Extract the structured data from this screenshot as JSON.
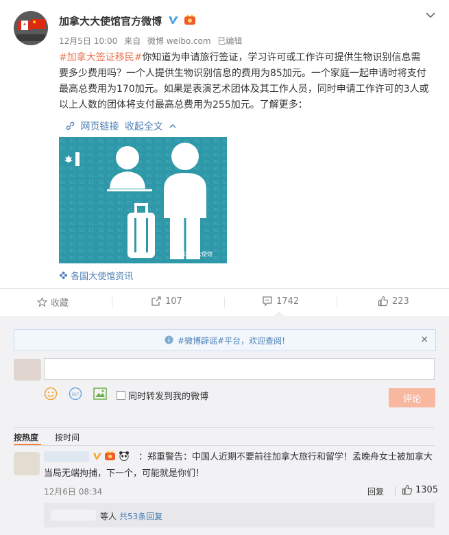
{
  "post": {
    "author": "加拿大大使馆官方微博",
    "date": "12月5日 10:00",
    "source_prefix": "来自",
    "source": "微博 weibo.com",
    "edited": "已编辑",
    "hashtag": "#加拿大签证移民#",
    "text": "你知道为申请旅行签证，学习许可或工作许可提供生物识别信息需要多少费用吗？一个人提供生物识别信息的费用为85加元。一个家庭一起申请时将支付最高总费用为170加元。如果是表演艺术团体及其工作人员，同时申请工作许可的3人或以上人数的团体将支付最高总费用为255加元。了解更多：",
    "web_link": "网页链接",
    "collapse": "收起全文",
    "image_watermark": "@加拿大大使馆",
    "topic_source": "各国大使馆资讯"
  },
  "actions": {
    "favorite": "收藏",
    "repost_count": "107",
    "comment_count": "1742",
    "like_count": "223"
  },
  "comment_box": {
    "notice_tag": "#微博辟谣#",
    "notice_text": "平台，欢迎查阅!",
    "close": "×",
    "repost_also": "同时转发到我的微博",
    "submit": "评论",
    "gif": "GIF"
  },
  "sort": {
    "by_hot": "按热度",
    "by_time": "按时间"
  },
  "comments": [
    {
      "text": "：郑重警告：中国人近期不要前往加拿大旅行和留学！孟晚舟女士被加拿大当局无端拘捕，下一个，可能就是你们！",
      "time": "12月6日 08:34",
      "reply": "回复",
      "likes": "1305",
      "sub_prefix": "等人",
      "sub_count": "共53条回复"
    }
  ],
  "colors": {
    "accent": "#eb7350",
    "link": "#4d7fb5",
    "image_bg": "#2e98a8"
  }
}
